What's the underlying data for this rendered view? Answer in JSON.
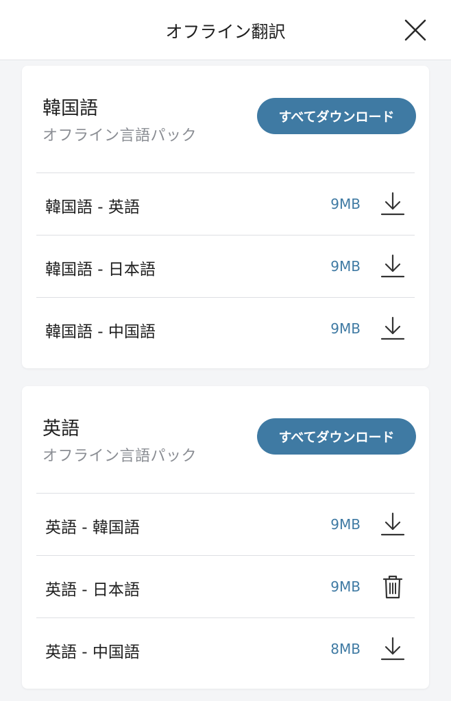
{
  "header": {
    "title": "オフライン翻訳",
    "close_icon": "close-icon"
  },
  "colors": {
    "accent": "#3f7aa3",
    "subtitle": "#8a8d93",
    "divider": "#dddfe3",
    "background": "#f4f5f7"
  },
  "sections": [
    {
      "title": "韓国語",
      "subtitle": "オフライン言語パック",
      "download_all_label": "すべてダウンロード",
      "packs": [
        {
          "name": "韓国語 - 英語",
          "size": "9MB",
          "action_icon": "download-icon"
        },
        {
          "name": "韓国語 - 日本語",
          "size": "9MB",
          "action_icon": "download-icon"
        },
        {
          "name": "韓国語 - 中国語",
          "size": "9MB",
          "action_icon": "download-icon"
        }
      ]
    },
    {
      "title": "英語",
      "subtitle": "オフライン言語パック",
      "download_all_label": "すべてダウンロード",
      "packs": [
        {
          "name": "英語 - 韓国語",
          "size": "9MB",
          "action_icon": "download-icon"
        },
        {
          "name": "英語 - 日本語",
          "size": "9MB",
          "action_icon": "trash-icon"
        },
        {
          "name": "英語 - 中国語",
          "size": "8MB",
          "action_icon": "download-icon"
        }
      ]
    }
  ]
}
